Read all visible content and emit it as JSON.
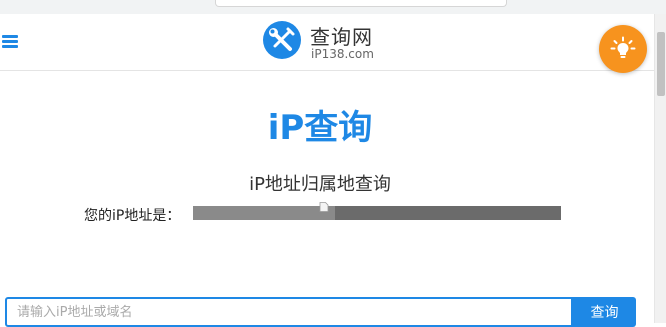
{
  "header": {
    "logo_title": "查询网",
    "logo_domain": "iP138.com"
  },
  "main": {
    "title": "iP查询",
    "subtitle": "iP地址归属地查询",
    "ip_label": "您的iP地址是："
  },
  "search": {
    "placeholder": "请输入iP地址或域名",
    "button_label": "查询"
  },
  "icons": {
    "menu": "hamburger-menu-icon",
    "logo": "wrench-screwdriver-logo-icon",
    "idea": "lightbulb-icon",
    "broken_image": "broken-image-icon"
  },
  "colors": {
    "accent": "#1e88e5",
    "idea_button": "#f7931e",
    "redaction": "#6b6b6b"
  }
}
